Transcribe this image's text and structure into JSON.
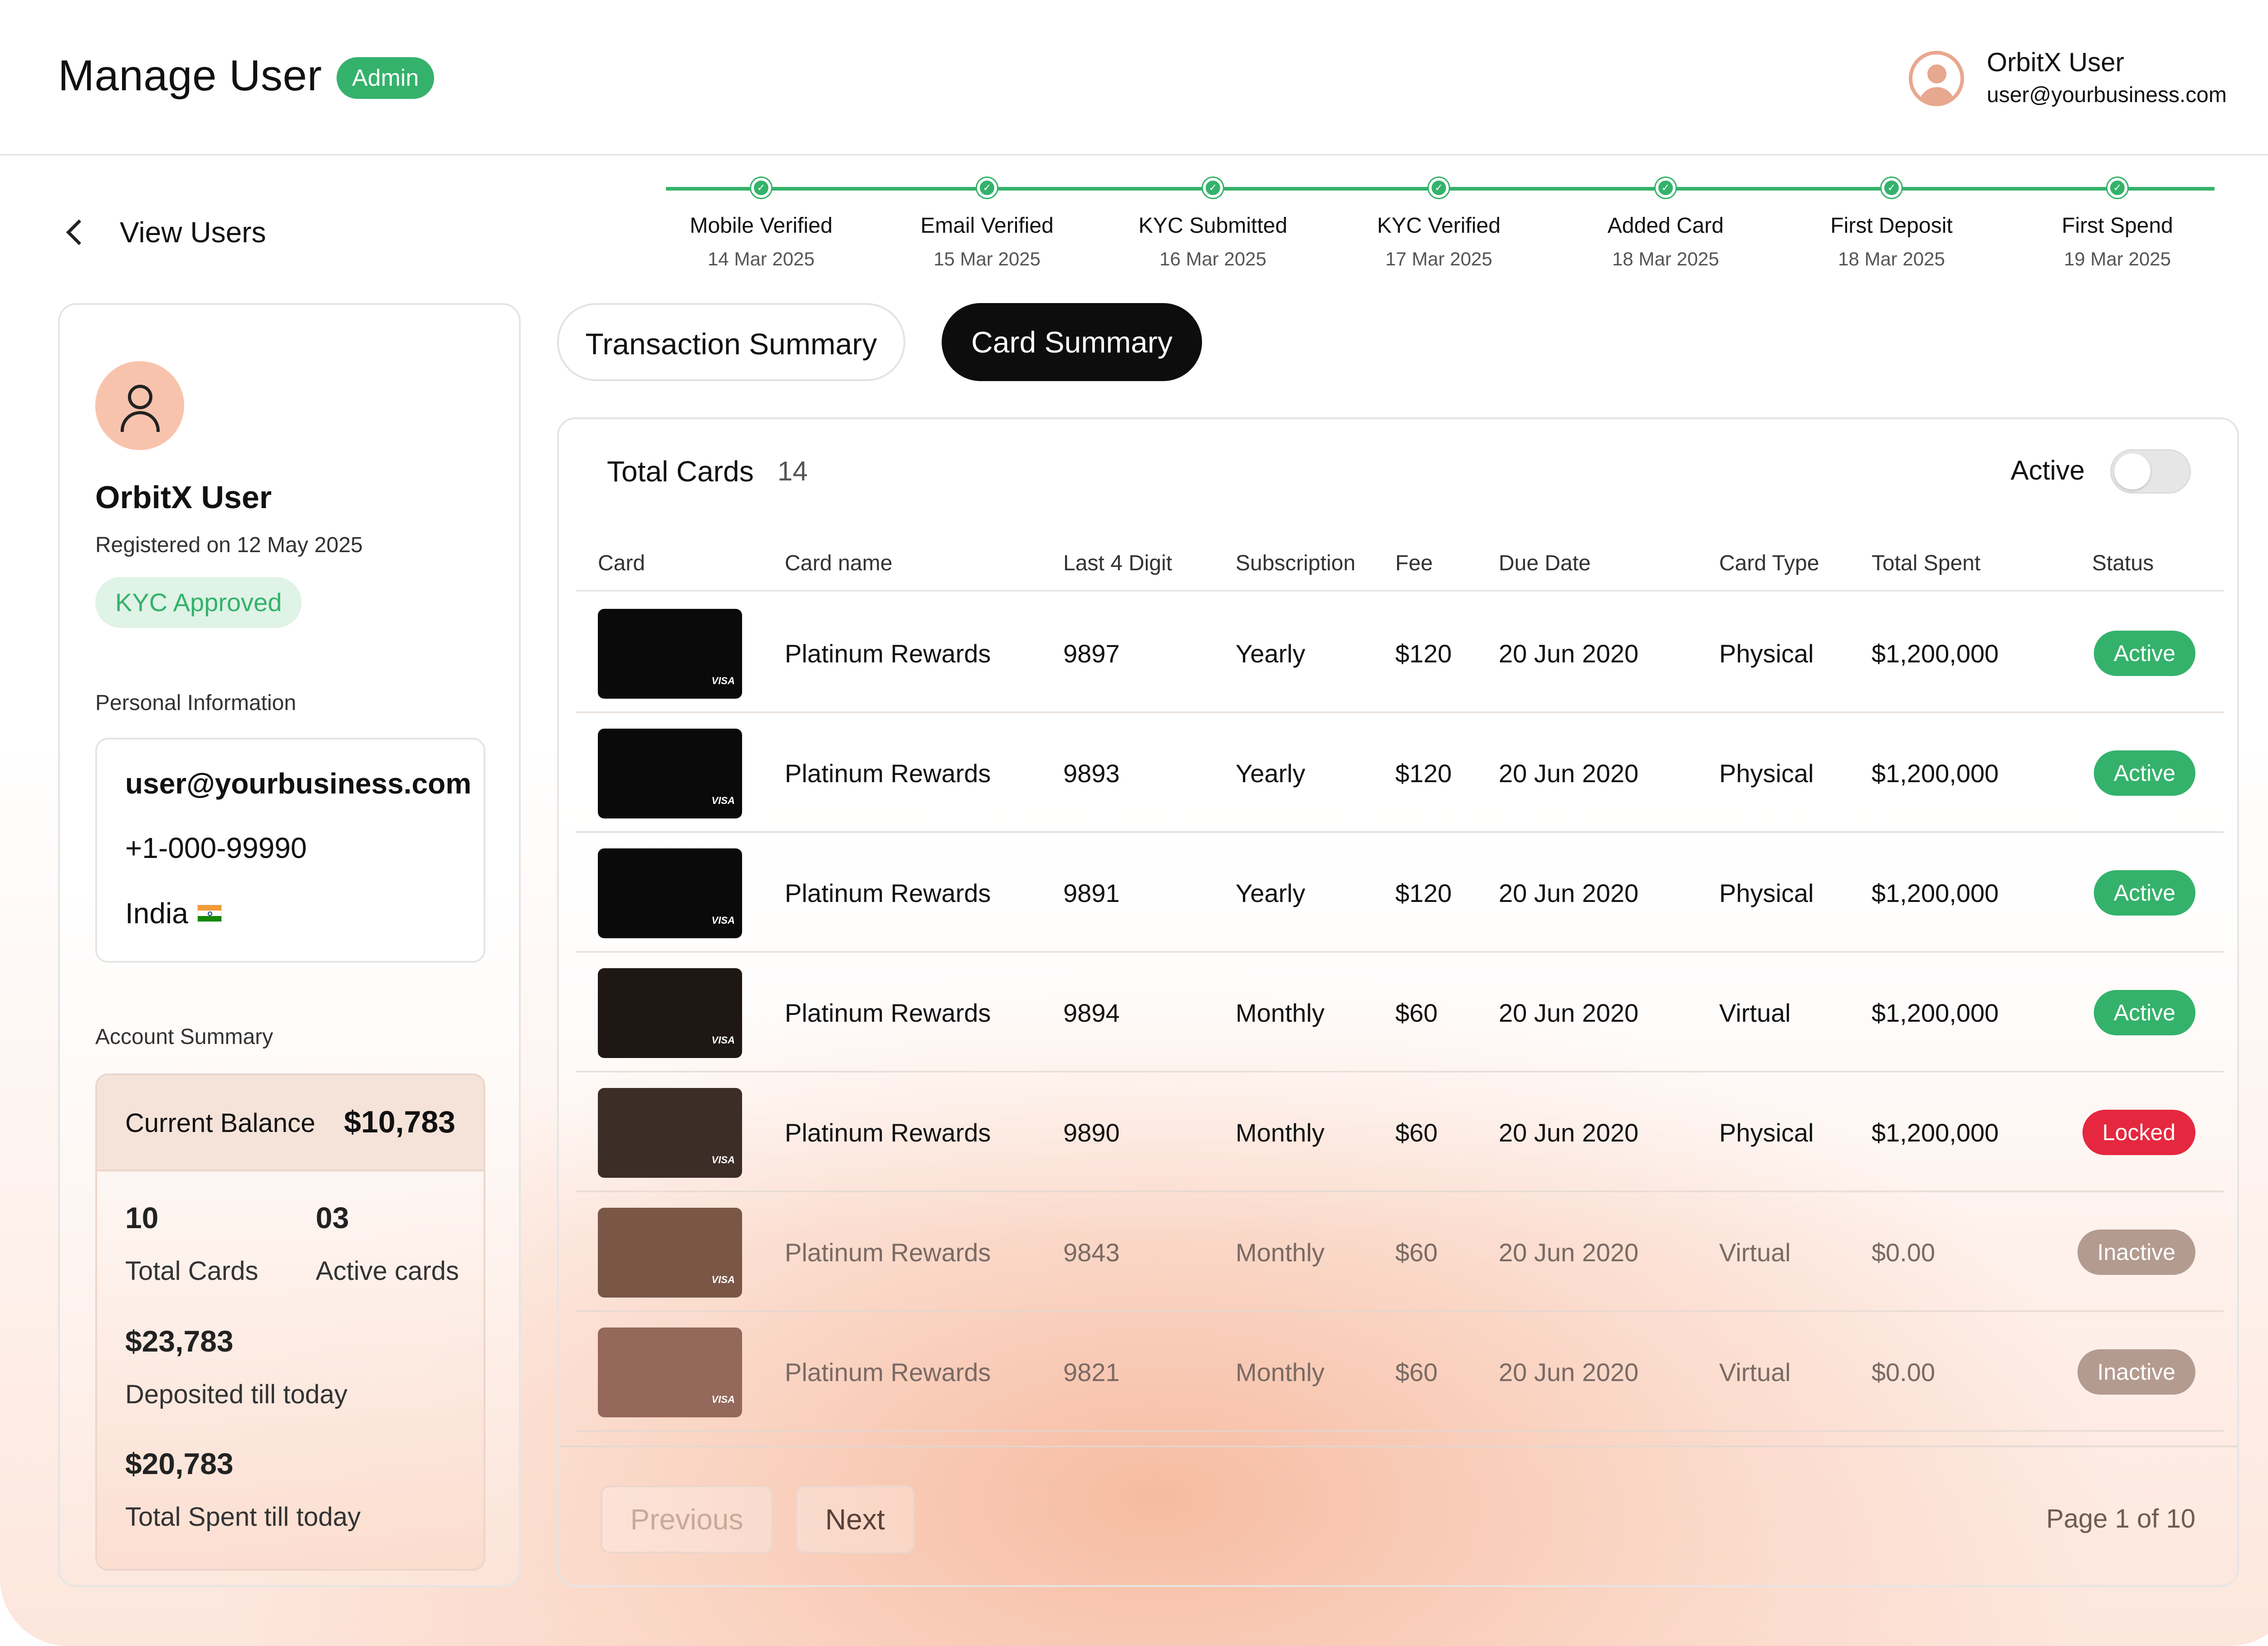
{
  "header": {
    "title": "Manage User",
    "role_badge": "Admin",
    "user": {
      "name": "OrbitX User",
      "email": "user@yourbusiness.com"
    }
  },
  "back_link": {
    "label": "View Users"
  },
  "timeline": [
    {
      "label": "Mobile Verified",
      "date": "14 Mar 2025"
    },
    {
      "label": "Email Verified",
      "date": "15 Mar 2025"
    },
    {
      "label": "KYC Submitted",
      "date": "16 Mar 2025"
    },
    {
      "label": "KYC Verified",
      "date": "17 Mar 2025"
    },
    {
      "label": "Added Card",
      "date": "18 Mar 2025"
    },
    {
      "label": "First Deposit",
      "date": "18 Mar 2025"
    },
    {
      "label": "First Spend",
      "date": "19 Mar 2025"
    }
  ],
  "profile": {
    "name": "OrbitX User",
    "registered": "Registered on 12 May 2025",
    "kyc_status": "KYC Approved",
    "personal_info_label": "Personal Information",
    "email": "user@yourbusiness.com",
    "phone": "+1-000-99990",
    "country": "India",
    "account_summary_label": "Account Summary",
    "current_balance_label": "Current Balance",
    "current_balance": "$10,783",
    "total_cards_value": "10",
    "total_cards_label": "Total Cards",
    "active_cards_value": "03",
    "active_cards_label": "Active cards",
    "deposited_value": "$23,783",
    "deposited_label": "Deposited till today",
    "spent_value": "$20,783",
    "spent_label": "Total Spent till today"
  },
  "tabs": {
    "transaction": "Transaction Summary",
    "card": "Card Summary",
    "active_tab": "Card Summary"
  },
  "cards_table": {
    "title": "Total Cards",
    "count": "14",
    "filter_label": "Active",
    "filter_on": false,
    "columns": [
      "Card",
      "Card name",
      "Last 4 Digit",
      "Subscription",
      "Fee",
      "Due Date",
      "Card Type",
      "Total Spent",
      "Status"
    ],
    "rows": [
      {
        "name": "Platinum Rewards",
        "last4": "9897",
        "subscription": "Yearly",
        "fee": "$120",
        "due": "20 Jun 2020",
        "type": "Physical",
        "spent": "$1,200,000",
        "status": "Active",
        "card_color": "#0a0a0a",
        "status_color": "#34b26b"
      },
      {
        "name": "Platinum Rewards",
        "last4": "9893",
        "subscription": "Yearly",
        "fee": "$120",
        "due": "20 Jun 2020",
        "type": "Physical",
        "spent": "$1,200,000",
        "status": "Active",
        "card_color": "#0a0a0a",
        "status_color": "#34b26b"
      },
      {
        "name": "Platinum Rewards",
        "last4": "9891",
        "subscription": "Yearly",
        "fee": "$120",
        "due": "20 Jun 2020",
        "type": "Physical",
        "spent": "$1,200,000",
        "status": "Active",
        "card_color": "#0a0a0a",
        "status_color": "#34b26b"
      },
      {
        "name": "Platinum Rewards",
        "last4": "9894",
        "subscription": "Monthly",
        "fee": "$60",
        "due": "20 Jun 2020",
        "type": "Virtual",
        "spent": "$1,200,000",
        "status": "Active",
        "card_color": "#1f1714",
        "status_color": "#34b26b"
      },
      {
        "name": "Platinum Rewards",
        "last4": "9890",
        "subscription": "Monthly",
        "fee": "$60",
        "due": "20 Jun 2020",
        "type": "Physical",
        "spent": "$1,200,000",
        "status": "Locked",
        "card_color": "#3d2d27",
        "status_color": "#e5283f"
      },
      {
        "name": "Platinum Rewards",
        "last4": "9843",
        "subscription": "Monthly",
        "fee": "$60",
        "due": "20 Jun 2020",
        "type": "Virtual",
        "spent": "$0.00",
        "status": "Inactive",
        "card_color": "#7a5647",
        "status_color": "#b49b90"
      },
      {
        "name": "Platinum Rewards",
        "last4": "9821",
        "subscription": "Monthly",
        "fee": "$60",
        "due": "20 Jun 2020",
        "type": "Virtual",
        "spent": "$0.00",
        "status": "Inactive",
        "card_color": "#94685a",
        "status_color": "#b49b90"
      }
    ],
    "pagination": {
      "previous": "Previous",
      "next": "Next",
      "page_text": "Page 1 of 10"
    }
  },
  "colors": {
    "accent_green": "#34b26b",
    "locked_red": "#e5283f",
    "peach": "#f8c3ad"
  },
  "icons": {
    "back": "chevron-left-icon",
    "user": "user-icon",
    "check": "check-icon",
    "flag": "india-flag-icon"
  }
}
